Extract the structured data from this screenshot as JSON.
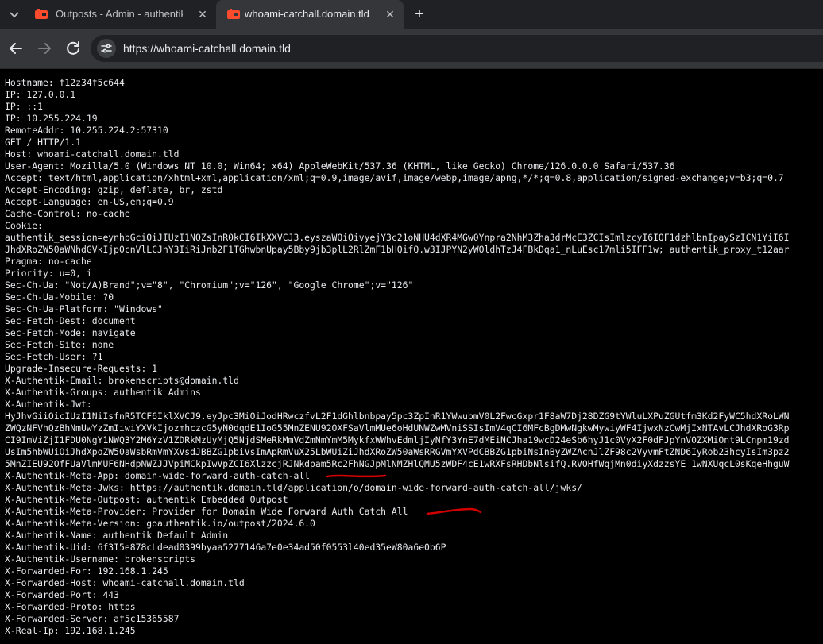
{
  "tabs": [
    {
      "title": "Outposts - Admin - authentik",
      "active": false,
      "favicon": "authentik-icon"
    },
    {
      "title": "whoami-catchall.domain.tld",
      "active": true,
      "favicon": "authentik-icon"
    }
  ],
  "toolbar": {
    "url": "https://whoami-catchall.domain.tld",
    "icons": [
      "back-arrow-icon",
      "forward-arrow-icon",
      "reload-icon",
      "site-info-icon"
    ]
  },
  "colors": {
    "tabstrip": "#202124",
    "toolbar": "#35363a",
    "page_background": "#000000",
    "page_text": "#e8eaed",
    "annotation": "#d40000",
    "favicon": "#fd4b2d"
  },
  "content": {
    "lines": [
      "Hostname: f12z34f5c644",
      "IP: 127.0.0.1",
      "IP: ::1",
      "IP: 10.255.224.19",
      "RemoteAddr: 10.255.224.2:57310",
      "GET / HTTP/1.1",
      "Host: whoami-catchall.domain.tld",
      "User-Agent: Mozilla/5.0 (Windows NT 10.0; Win64; x64) AppleWebKit/537.36 (KHTML, like Gecko) Chrome/126.0.0.0 Safari/537.36",
      "Accept: text/html,application/xhtml+xml,application/xml;q=0.9,image/avif,image/webp,image/apng,*/*;q=0.8,application/signed-exchange;v=b3;q=0.7",
      "Accept-Encoding: gzip, deflate, br, zstd",
      "Accept-Language: en-US,en;q=0.9",
      "Cache-Control: no-cache",
      "Cookie:",
      "authentik_session=eynhbGciOiJIUzI1NQZsInR0kCI6IkXXVCJ3.eyszaWQiOivyejY3c21oNHU4dXR4MGw0Ynpra2NhM3Zha3drMcE3ZCIsImlzcyI6IQF1dzhlbnIpaySzICN1YiI6I",
      "JhdXRoZW50aWNhdGVkIjp0cnVlLCJhY3IiRiJnb2F1TGhwbnUpay5Bby9jb3plL2RlZmF1bHQifQ.w3IJPYN2yWOldhTzJ4FBkDqa1_nLuEsc17mli5IFF1w; authentik_proxy_t12aar",
      "Pragma: no-cache",
      "Priority: u=0, i",
      "Sec-Ch-Ua: \"Not/A)Brand\";v=\"8\", \"Chromium\";v=\"126\", \"Google Chrome\";v=\"126\"",
      "Sec-Ch-Ua-Mobile: ?0",
      "Sec-Ch-Ua-Platform: \"Windows\"",
      "Sec-Fetch-Dest: document",
      "Sec-Fetch-Mode: navigate",
      "Sec-Fetch-Site: none",
      "Sec-Fetch-User: ?1",
      "Upgrade-Insecure-Requests: 1",
      "X-Authentik-Email: brokenscripts@domain.tld",
      "X-Authentik-Groups: authentik Admins",
      "X-Authentik-Jwt:",
      "HyJhvGiiOicIUzI1NiIsfnR5TCF6IklXVCJ9.eyJpc3MiOiJodHRwczfvL2F1dGhlbnbpay5pc3ZpInR1YWwubmV0L2FwcGxpr1F8aW7Dj28DZG9tYWluLXPuZGUtfm3Kd2FyWC5hdXRoLWN",
      "ZWQzNFVhQzBhNmUwYzZmIiwiYXVkIjozmhczcG5yN0dqdE1IoG55MnZENU92OXFSaVlmMUe6oHdUNWZwMVniSSIsImV4qCI6MFcBgDMwNgkwMywiyWF4IjwxNzCwMjIxNTAvLCJhdXRoG3Rp",
      "CI9ImViZjI1FDU0NgY1NWQ3Y2M6YzV1ZDRkMzUyMjQ5NjdSMeRkMmVdZmNmYmM5MykfxWWhvEdmljIyNfY3YnE7dMEiNCJha19wcD24eSb6hyJ1c0VyX2F0dFJpYnV0ZXMiOnt9LCnpm19zd",
      "UsIm5hbWUiOiJhdXpoZW50aWsbRmVmYXVsdJBBZG1pbiVsImApRmVuX25LbWUiZiJhdXRoZW50aWsRRGVmYXVPdCBBZG1pbiNsInByZWZAcnJlZF98c2VyvmFtZND6IyRob23hcyIsIm3pz2",
      "5MnZIEU92OfFUaVlmMUF6NHdpNWZJJVpiMCkpIwVpZCI6XlzzcjRJNkdpam5Rc2FhNGJpMlNMZHlQMU5zWDF4cE1wRXFsRHDbNlsifQ.RVOHfWqjMn0diyXdzzsYE_1wNXUqcL0sKqeHhguW",
      "X-Authentik-Meta-App: domain-wide-forward-auth-catch-all",
      "X-Authentik-Meta-Jwks: https://authentik.domain.tld/application/o/domain-wide-forward-auth-catch-all/jwks/",
      "X-Authentik-Meta-Outpost: authentik Embedded Outpost",
      "X-Authentik-Meta-Provider: Provider for Domain Wide Forward Auth Catch All",
      "X-Authentik-Meta-Version: goauthentik.io/outpost/2024.6.0",
      "X-Authentik-Name: authentik Default Admin",
      "X-Authentik-Uid: 6f3I5e878cLdead0399byaa5277146a7e0e34ad50f0553l40ed35eW80a6e0b6P",
      "X-Authentik-Username: brokenscripts",
      "X-Forwarded-For: 192.168.1.245",
      "X-Forwarded-Host: whoami-catchall.domain.tld",
      "X-Forwarded-Port: 443",
      "X-Forwarded-Proto: https",
      "X-Forwarded-Server: af5c15365587",
      "X-Real-Ip: 192.168.1.245"
    ]
  }
}
